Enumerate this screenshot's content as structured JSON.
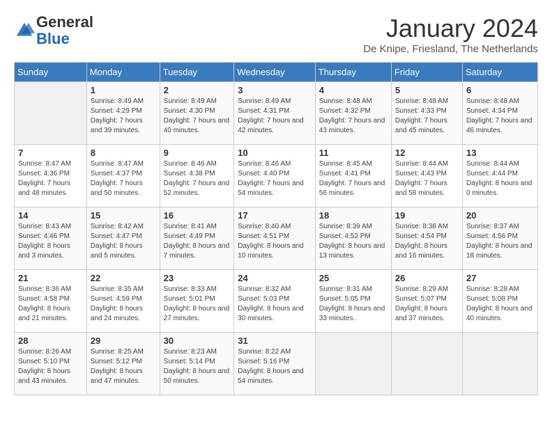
{
  "logo": {
    "general": "General",
    "blue": "Blue"
  },
  "header": {
    "title": "January 2024",
    "subtitle": "De Knipe, Friesland, The Netherlands"
  },
  "weekdays": [
    "Sunday",
    "Monday",
    "Tuesday",
    "Wednesday",
    "Thursday",
    "Friday",
    "Saturday"
  ],
  "weeks": [
    [
      {
        "day": "",
        "sunrise": "",
        "sunset": "",
        "daylight": ""
      },
      {
        "day": "1",
        "sunrise": "Sunrise: 8:49 AM",
        "sunset": "Sunset: 4:29 PM",
        "daylight": "Daylight: 7 hours and 39 minutes."
      },
      {
        "day": "2",
        "sunrise": "Sunrise: 8:49 AM",
        "sunset": "Sunset: 4:30 PM",
        "daylight": "Daylight: 7 hours and 40 minutes."
      },
      {
        "day": "3",
        "sunrise": "Sunrise: 8:49 AM",
        "sunset": "Sunset: 4:31 PM",
        "daylight": "Daylight: 7 hours and 42 minutes."
      },
      {
        "day": "4",
        "sunrise": "Sunrise: 8:48 AM",
        "sunset": "Sunset: 4:32 PM",
        "daylight": "Daylight: 7 hours and 43 minutes."
      },
      {
        "day": "5",
        "sunrise": "Sunrise: 8:48 AM",
        "sunset": "Sunset: 4:33 PM",
        "daylight": "Daylight: 7 hours and 45 minutes."
      },
      {
        "day": "6",
        "sunrise": "Sunrise: 8:48 AM",
        "sunset": "Sunset: 4:34 PM",
        "daylight": "Daylight: 7 hours and 46 minutes."
      }
    ],
    [
      {
        "day": "7",
        "sunrise": "Sunrise: 8:47 AM",
        "sunset": "Sunset: 4:36 PM",
        "daylight": "Daylight: 7 hours and 48 minutes."
      },
      {
        "day": "8",
        "sunrise": "Sunrise: 8:47 AM",
        "sunset": "Sunset: 4:37 PM",
        "daylight": "Daylight: 7 hours and 50 minutes."
      },
      {
        "day": "9",
        "sunrise": "Sunrise: 8:46 AM",
        "sunset": "Sunset: 4:38 PM",
        "daylight": "Daylight: 7 hours and 52 minutes."
      },
      {
        "day": "10",
        "sunrise": "Sunrise: 8:46 AM",
        "sunset": "Sunset: 4:40 PM",
        "daylight": "Daylight: 7 hours and 54 minutes."
      },
      {
        "day": "11",
        "sunrise": "Sunrise: 8:45 AM",
        "sunset": "Sunset: 4:41 PM",
        "daylight": "Daylight: 7 hours and 56 minutes."
      },
      {
        "day": "12",
        "sunrise": "Sunrise: 8:44 AM",
        "sunset": "Sunset: 4:43 PM",
        "daylight": "Daylight: 7 hours and 58 minutes."
      },
      {
        "day": "13",
        "sunrise": "Sunrise: 8:44 AM",
        "sunset": "Sunset: 4:44 PM",
        "daylight": "Daylight: 8 hours and 0 minutes."
      }
    ],
    [
      {
        "day": "14",
        "sunrise": "Sunrise: 8:43 AM",
        "sunset": "Sunset: 4:46 PM",
        "daylight": "Daylight: 8 hours and 3 minutes."
      },
      {
        "day": "15",
        "sunrise": "Sunrise: 8:42 AM",
        "sunset": "Sunset: 4:47 PM",
        "daylight": "Daylight: 8 hours and 5 minutes."
      },
      {
        "day": "16",
        "sunrise": "Sunrise: 8:41 AM",
        "sunset": "Sunset: 4:49 PM",
        "daylight": "Daylight: 8 hours and 7 minutes."
      },
      {
        "day": "17",
        "sunrise": "Sunrise: 8:40 AM",
        "sunset": "Sunset: 4:51 PM",
        "daylight": "Daylight: 8 hours and 10 minutes."
      },
      {
        "day": "18",
        "sunrise": "Sunrise: 8:39 AM",
        "sunset": "Sunset: 4:52 PM",
        "daylight": "Daylight: 8 hours and 13 minutes."
      },
      {
        "day": "19",
        "sunrise": "Sunrise: 8:38 AM",
        "sunset": "Sunset: 4:54 PM",
        "daylight": "Daylight: 8 hours and 16 minutes."
      },
      {
        "day": "20",
        "sunrise": "Sunrise: 8:37 AM",
        "sunset": "Sunset: 4:56 PM",
        "daylight": "Daylight: 8 hours and 18 minutes."
      }
    ],
    [
      {
        "day": "21",
        "sunrise": "Sunrise: 8:36 AM",
        "sunset": "Sunset: 4:58 PM",
        "daylight": "Daylight: 8 hours and 21 minutes."
      },
      {
        "day": "22",
        "sunrise": "Sunrise: 8:35 AM",
        "sunset": "Sunset: 4:59 PM",
        "daylight": "Daylight: 8 hours and 24 minutes."
      },
      {
        "day": "23",
        "sunrise": "Sunrise: 8:33 AM",
        "sunset": "Sunset: 5:01 PM",
        "daylight": "Daylight: 8 hours and 27 minutes."
      },
      {
        "day": "24",
        "sunrise": "Sunrise: 8:32 AM",
        "sunset": "Sunset: 5:03 PM",
        "daylight": "Daylight: 8 hours and 30 minutes."
      },
      {
        "day": "25",
        "sunrise": "Sunrise: 8:31 AM",
        "sunset": "Sunset: 5:05 PM",
        "daylight": "Daylight: 8 hours and 33 minutes."
      },
      {
        "day": "26",
        "sunrise": "Sunrise: 8:29 AM",
        "sunset": "Sunset: 5:07 PM",
        "daylight": "Daylight: 8 hours and 37 minutes."
      },
      {
        "day": "27",
        "sunrise": "Sunrise: 8:28 AM",
        "sunset": "Sunset: 5:08 PM",
        "daylight": "Daylight: 8 hours and 40 minutes."
      }
    ],
    [
      {
        "day": "28",
        "sunrise": "Sunrise: 8:26 AM",
        "sunset": "Sunset: 5:10 PM",
        "daylight": "Daylight: 8 hours and 43 minutes."
      },
      {
        "day": "29",
        "sunrise": "Sunrise: 8:25 AM",
        "sunset": "Sunset: 5:12 PM",
        "daylight": "Daylight: 8 hours and 47 minutes."
      },
      {
        "day": "30",
        "sunrise": "Sunrise: 8:23 AM",
        "sunset": "Sunset: 5:14 PM",
        "daylight": "Daylight: 8 hours and 50 minutes."
      },
      {
        "day": "31",
        "sunrise": "Sunrise: 8:22 AM",
        "sunset": "Sunset: 5:16 PM",
        "daylight": "Daylight: 8 hours and 54 minutes."
      },
      {
        "day": "",
        "sunrise": "",
        "sunset": "",
        "daylight": ""
      },
      {
        "day": "",
        "sunrise": "",
        "sunset": "",
        "daylight": ""
      },
      {
        "day": "",
        "sunrise": "",
        "sunset": "",
        "daylight": ""
      }
    ]
  ]
}
